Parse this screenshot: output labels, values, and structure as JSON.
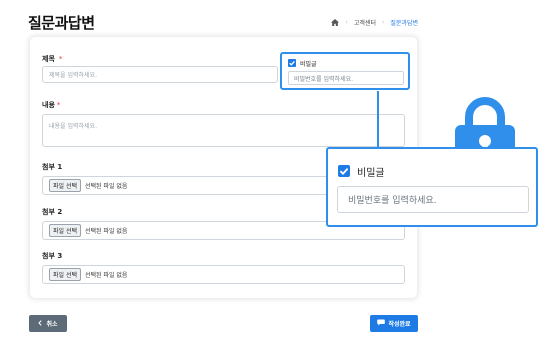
{
  "page": {
    "title": "질문과답변"
  },
  "breadcrumb": {
    "home_icon": "home-icon",
    "items": [
      "고객센터",
      "질문과답변"
    ],
    "separator": "›"
  },
  "form": {
    "title_label": "제목",
    "title_placeholder": "제목을 입력하세요.",
    "content_label": "내용",
    "content_placeholder": "내용을 입력하세요.",
    "required_mark": "*",
    "secret": {
      "label": "비밀글",
      "checked": true,
      "password_placeholder": "비밀번호를 입력하세요."
    },
    "attachments": [
      {
        "label": "첨부 1",
        "button": "파일 선택",
        "status": "선택된 파일 없음"
      },
      {
        "label": "첨부 2",
        "button": "파일 선택",
        "status": "선택된 파일 없음"
      },
      {
        "label": "첨부 3",
        "button": "파일 선택",
        "status": "선택된 파일 없음"
      }
    ]
  },
  "zoom_callout": {
    "label": "비밀글",
    "password_placeholder": "비밀번호를 입력하세요.",
    "checked": true
  },
  "actions": {
    "cancel": "취소",
    "submit": "작성완료"
  },
  "colors": {
    "accent": "#1e7be6",
    "callout_border": "#2f8fea",
    "lock": "#2f8fea",
    "cancel_bg": "#5d6b78"
  },
  "icons": {
    "lock": "lock-icon",
    "check": "checkbox-checked-icon",
    "cancel": "chevron-left-icon",
    "submit": "speech-bubble-icon"
  }
}
